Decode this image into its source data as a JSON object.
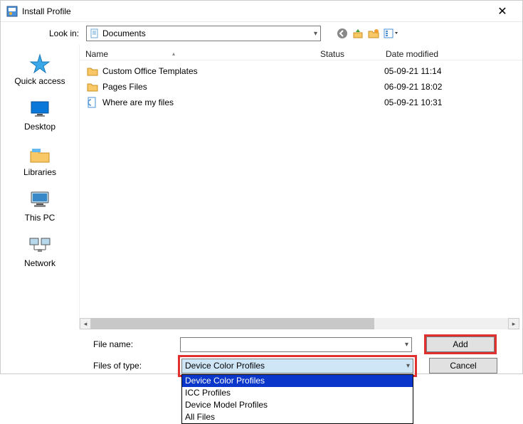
{
  "window": {
    "title": "Install Profile"
  },
  "lookin": {
    "label": "Look in:",
    "value": "Documents"
  },
  "places": {
    "quick_access": "Quick access",
    "desktop": "Desktop",
    "libraries": "Libraries",
    "this_pc": "This PC",
    "network": "Network"
  },
  "columns": {
    "name": "Name",
    "status": "Status",
    "date": "Date modified"
  },
  "files": [
    {
      "icon": "folder",
      "name": "Custom Office Templates",
      "status": "",
      "date": "05-09-21 11:14"
    },
    {
      "icon": "folder",
      "name": "Pages Files",
      "status": "",
      "date": "06-09-21 18:02"
    },
    {
      "icon": "html",
      "name": "Where are my files",
      "status": "",
      "date": "05-09-21 10:31"
    }
  ],
  "bottom": {
    "file_name_label": "File name:",
    "file_name_value": "",
    "file_type_label": "Files of type:",
    "file_type_value": "Device Color Profiles",
    "add_label": "Add",
    "cancel_label": "Cancel"
  },
  "filetype_options": [
    "Device Color Profiles",
    "ICC Profiles",
    "Device Model Profiles",
    "All Files"
  ],
  "toolbar_icons": [
    "back-icon",
    "up-icon",
    "new-folder-icon",
    "view-menu-icon"
  ]
}
